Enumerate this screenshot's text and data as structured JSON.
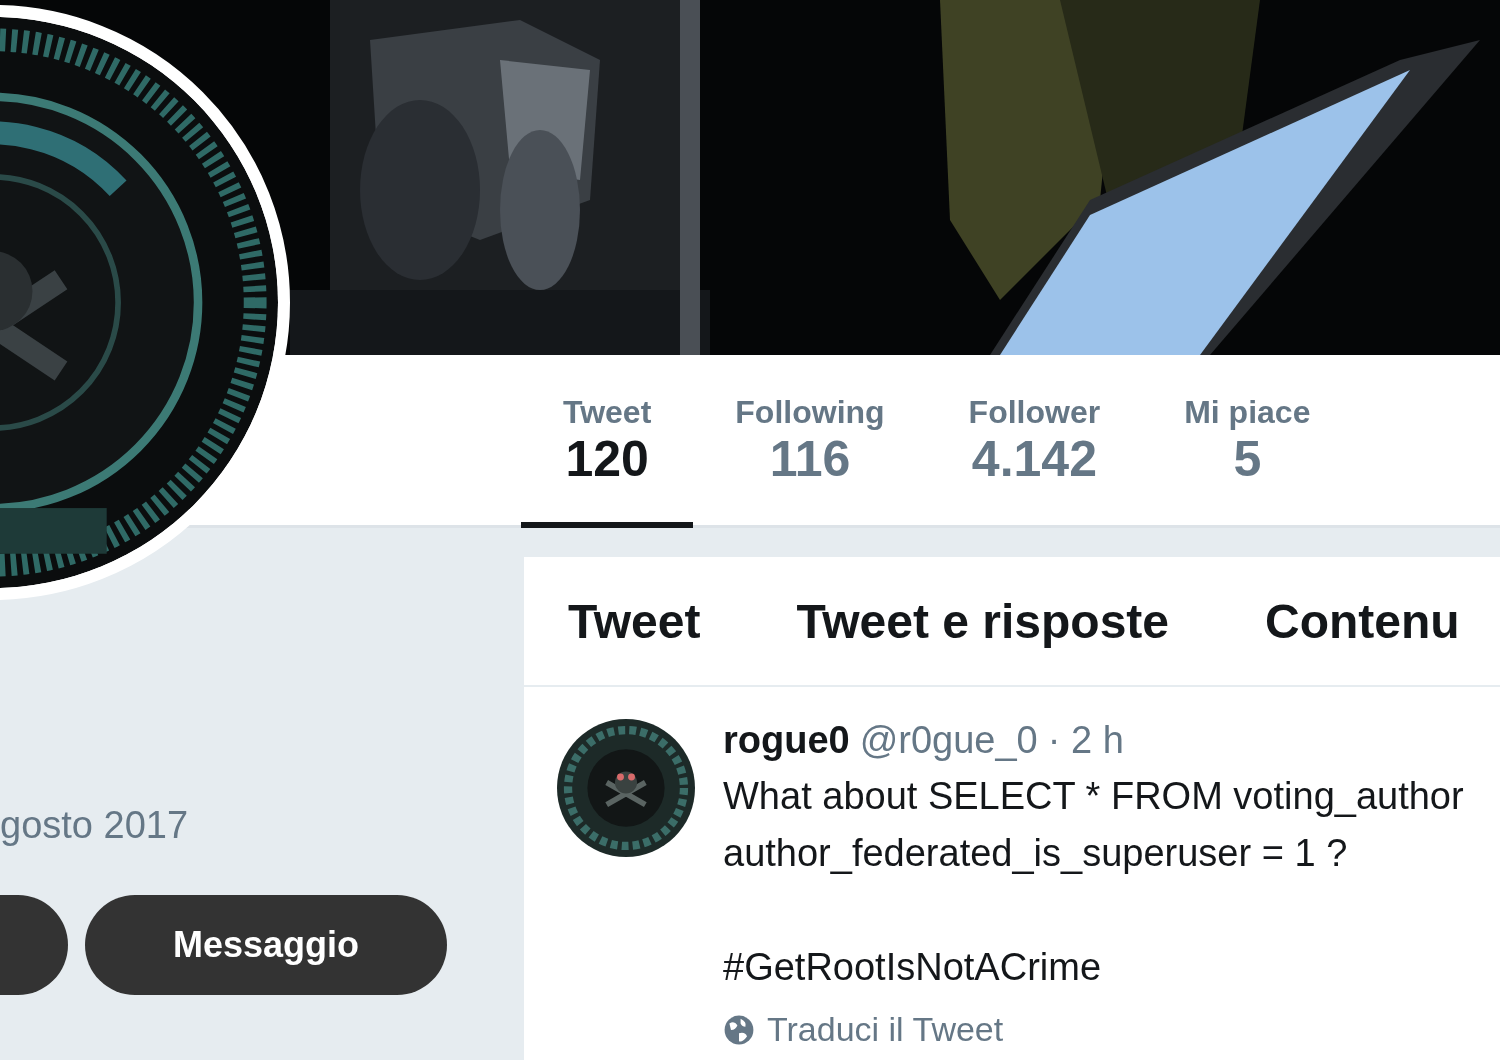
{
  "stats": [
    {
      "label": "Tweet",
      "value": "120",
      "selected": true
    },
    {
      "label": "Following",
      "value": "116",
      "selected": false
    },
    {
      "label": "Follower",
      "value": "4.142",
      "selected": false
    },
    {
      "label": "Mi piace",
      "value": "5",
      "selected": false
    }
  ],
  "profile": {
    "joined": "gosto 2017",
    "buttons": [
      "Messaggio"
    ]
  },
  "tabs": [
    {
      "label": "Tweet"
    },
    {
      "label": "Tweet e risposte"
    },
    {
      "label": "Contenu"
    }
  ],
  "tweet": {
    "name": "rogue0",
    "handle": "@r0gue_0",
    "time": "· 2 h",
    "text": "What about SELECT * FROM voting_author\nauthor_federated_is_superuser = 1 ?",
    "hashtag": "#GetRootIsNotACrime",
    "translate": "Traduci il Tweet"
  }
}
